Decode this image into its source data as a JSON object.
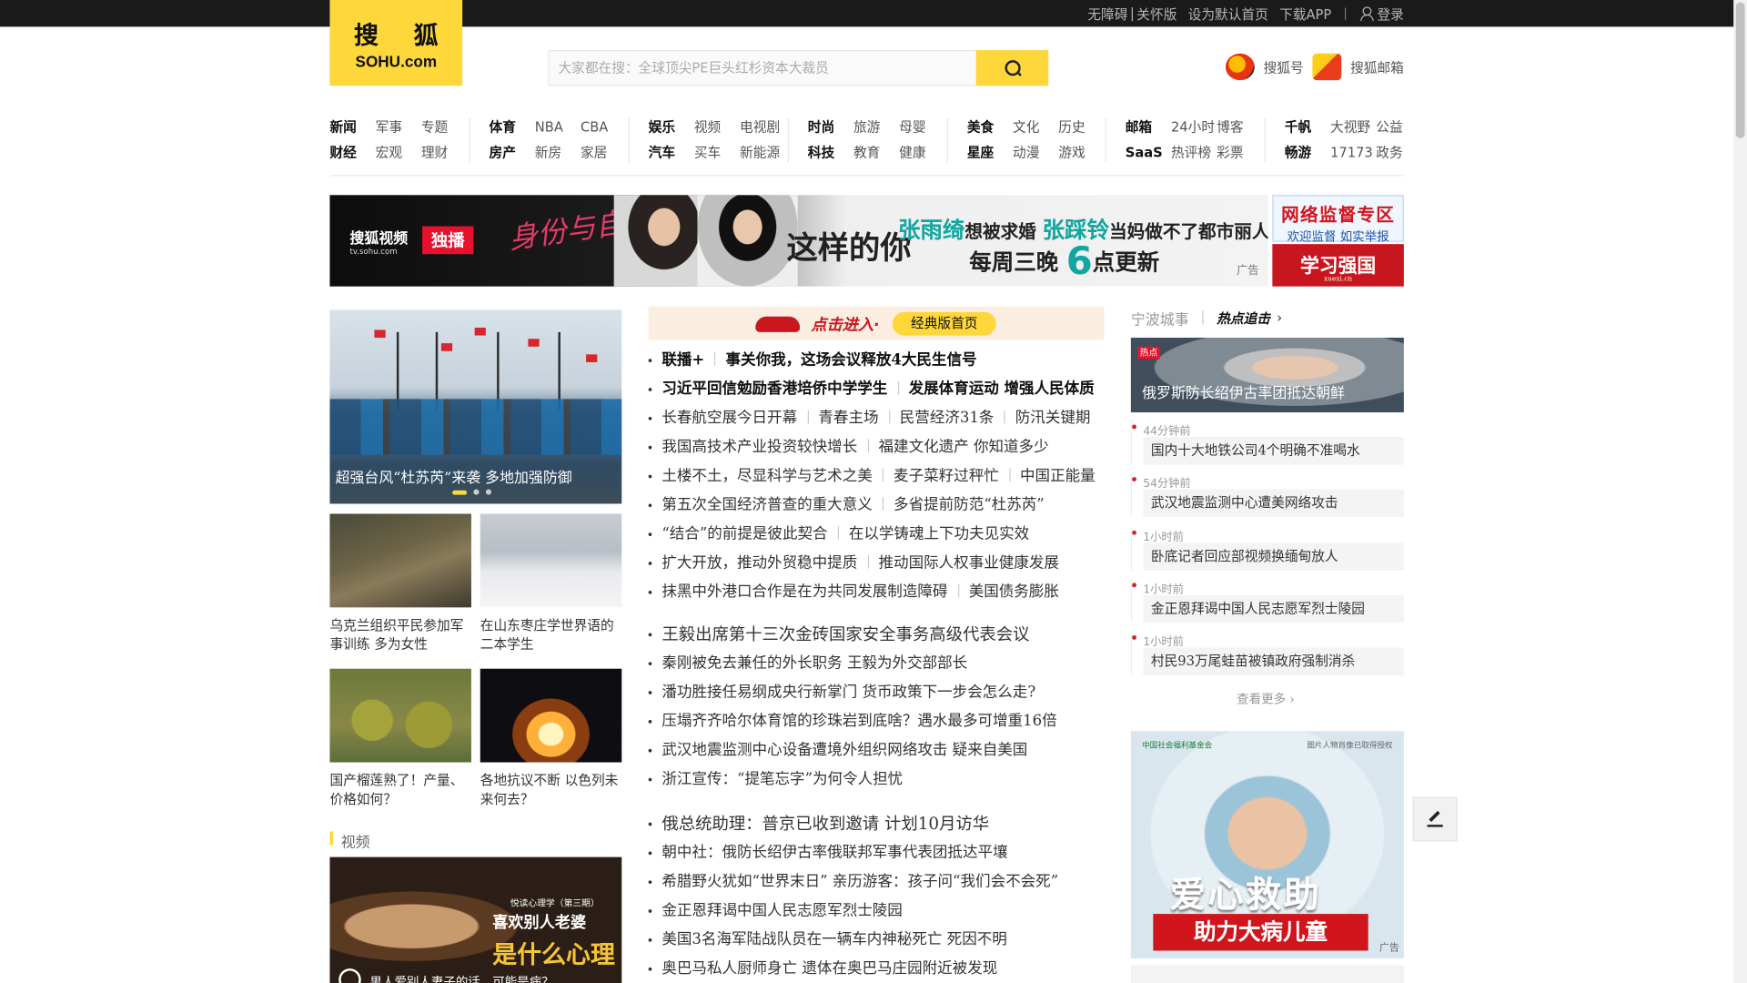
{
  "topbar": {
    "links": [
      "无障碍",
      "关怀版",
      "设为默认首页",
      "下载APP"
    ],
    "login": "登录"
  },
  "logo": {
    "cn": "搜 狐",
    "en": "SOHU.com"
  },
  "search": {
    "placeholder": "大家都在搜：全球顶尖PE巨头红杉资本大裁员"
  },
  "quick_links": {
    "sohuhao": "搜狐号",
    "mail": "搜狐邮箱"
  },
  "nav": [
    {
      "row1": [
        "新闻",
        "军事",
        "专题"
      ],
      "row2": [
        "财经",
        "宏观",
        "理财"
      ]
    },
    {
      "row1": [
        "体育",
        "NBA",
        "CBA"
      ],
      "row2": [
        "房产",
        "新房",
        "家居"
      ]
    },
    {
      "row1": [
        "娱乐",
        "视频",
        "电视剧"
      ],
      "row2": [
        "汽车",
        "买车",
        "新能源"
      ]
    },
    {
      "row1": [
        "时尚",
        "旅游",
        "母婴"
      ],
      "row2": [
        "科技",
        "教育",
        "健康"
      ]
    },
    {
      "row1": [
        "美食",
        "文化",
        "历史"
      ],
      "row2": [
        "星座",
        "动漫",
        "游戏"
      ]
    },
    {
      "row1": [
        "邮箱",
        "24小时",
        "博客"
      ],
      "row2": [
        "SaaS",
        "热评榜",
        "彩票"
      ]
    },
    {
      "row1": [
        "千帆",
        "大视野",
        "公益"
      ],
      "row2": [
        "畅游",
        "17173",
        "政务"
      ]
    }
  ],
  "banner": {
    "brand": "搜狐视频",
    "brand_url": "tv.sohu.com",
    "exclusive": "独播",
    "script_title": "身份与自我",
    "show": "这样的你",
    "line1_a": "张雨绮",
    "line1_b": "想被求婚",
    "line1_c": "张踩铃",
    "line1_d": "当妈做不了都市丽人",
    "line2_a": "每周三晚",
    "line2_num": "6",
    "line2_b": "点更新",
    "ad_tag": "广告"
  },
  "side_ads": {
    "supervise_title": "网络监督专区",
    "supervise_sub": "欢迎监督 如实举报",
    "xuexi": "学习强国",
    "xuexi_url": "xuexi.cn"
  },
  "left": {
    "focus_caption": "超强台风“杜苏芮”来袭 多地加强防御",
    "cards": [
      "乌克兰组织平民参加军事训练 多为女性",
      "在山东枣庄学世界语的二本学生",
      "国产榴莲熟了！产量、价格如何？",
      "各地抗议不断 以色列未来何去？"
    ],
    "video_label": "视频",
    "video": {
      "series": "悦读心理学（第三期）",
      "line1": "喜欢别人老婆",
      "line2": "是什么心理",
      "caption": "男人爱别人妻子的话，可能是病？"
    }
  },
  "center": {
    "classic": {
      "enter": "点击进入·",
      "button": "经典版首页"
    },
    "groups": [
      [
        {
          "items": [
            "联播+",
            "事关你我，这场会议释放4大民生信号"
          ],
          "hl": true
        },
        {
          "items": [
            "习近平回信勉励香港培侨中学学生",
            "发展体育运动 增强人民体质"
          ],
          "hl": true
        },
        {
          "items": [
            "长春航空展今日开幕",
            "青春主场",
            "民营经济31条",
            "防汛关键期"
          ]
        },
        {
          "items": [
            "我国高技术产业投资较快增长",
            "福建文化遗产 你知道多少"
          ]
        },
        {
          "items": [
            "土楼不土，尽显科学与艺术之美",
            "麦子菜籽过秤忙",
            "中国正能量"
          ]
        },
        {
          "items": [
            "第五次全国经济普查的重大意义",
            "多省提前防范“杜苏芮”"
          ]
        },
        {
          "items": [
            "“结合”的前提是彼此契合",
            "在以学铸魂上下功夫见实效"
          ]
        },
        {
          "items": [
            "扩大开放，推动外贸稳中提质",
            "推动国际人权事业健康发展"
          ]
        },
        {
          "items": [
            "抹黑中外港口合作是在为共同发展制造障碍",
            "美国债务膨胀"
          ]
        }
      ],
      [
        {
          "items": [
            "王毅出席第十三次金砖国家安全事务高级代表会议"
          ],
          "big": true
        },
        {
          "items": [
            "秦刚被免去兼任的外长职务 王毅为外交部部长"
          ]
        },
        {
          "items": [
            "潘功胜接任易纲成央行新掌门 货币政策下一步会怎么走?"
          ]
        },
        {
          "items": [
            "压塌齐齐哈尔体育馆的珍珠岩到底啥？遇水最多可增重16倍"
          ]
        },
        {
          "items": [
            "武汉地震监测中心设备遭境外组织网络攻击 疑来自美国"
          ]
        },
        {
          "items": [
            "浙江宣传：“提笔忘字”为何令人担忧"
          ]
        }
      ],
      [
        {
          "items": [
            "俄总统助理：普京已收到邀请 计划10月访华"
          ],
          "big": true
        },
        {
          "items": [
            "朝中社：俄防长绍伊古率俄联邦军事代表团抵达平壤"
          ]
        },
        {
          "items": [
            "希腊野火犹如“世界末日” 亲历游客：孩子问“我们会不会死”"
          ]
        },
        {
          "items": [
            "金正恩拜谒中国人民志愿军烈士陵园"
          ]
        },
        {
          "items": [
            "美国3名海军陆战队员在一辆车内神秘死亡 死因不明"
          ]
        },
        {
          "items": [
            "奥巴马私人厨师身亡 遗体在奥巴马庄园附近被发现"
          ]
        }
      ]
    ]
  },
  "right": {
    "city": "宁波城事",
    "hot": "热点追击",
    "focus_badge": "热点",
    "focus_caption": "俄罗斯防长绍伊古率团抵达朝鲜",
    "feed": [
      {
        "time": "44分钟前",
        "title": "国内十大地铁公司4个明确不准喝水"
      },
      {
        "time": "54分钟前",
        "title": "武汉地震监测中心遭美网络攻击"
      },
      {
        "time": "1小时前",
        "title": "卧底记者回应部视频换缅甸放人"
      },
      {
        "time": "1小时前",
        "title": "金正恩拜谒中国人民志愿军烈士陵园"
      },
      {
        "time": "1小时前",
        "title": "村民93万尾蛙苗被镇政府强制消杀"
      }
    ],
    "more": "查看更多",
    "ad": {
      "org": "中国社会福利基金会",
      "auth": "图片人物肖像已取得授权",
      "line1": "爱心救助",
      "line2": "助力大病儿童",
      "tag": "广告"
    }
  }
}
